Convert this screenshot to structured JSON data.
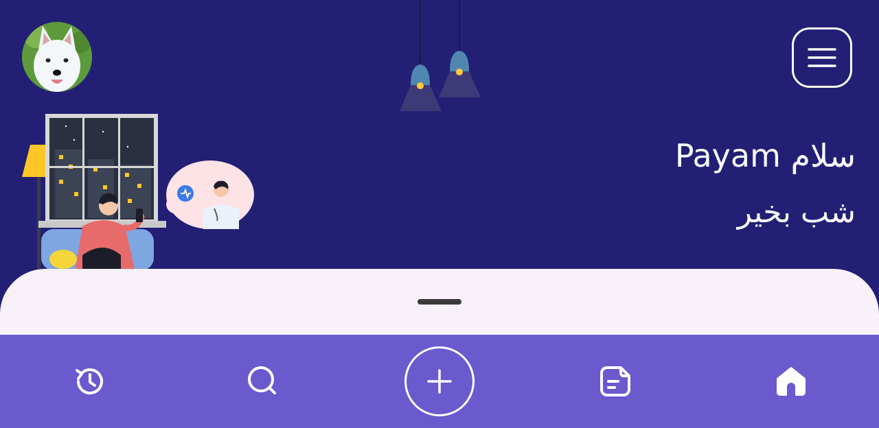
{
  "header": {
    "avatar_icon": "husky-dog-avatar",
    "menu_icon": "hamburger-menu-icon"
  },
  "greeting": {
    "hello": "سلام Payam",
    "time_of_day": "شب بخیر"
  },
  "bottom_nav": {
    "items": [
      "history-icon",
      "search-icon",
      "add-icon",
      "notes-icon",
      "home-icon"
    ],
    "active": "home-icon"
  },
  "colors": {
    "background": "#231f75",
    "sheet": "#f8f1fa",
    "nav": "#6a5acd"
  }
}
